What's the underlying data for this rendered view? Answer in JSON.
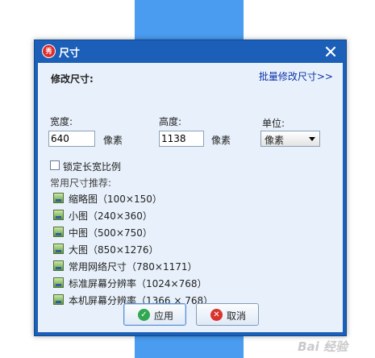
{
  "dialog": {
    "title": "尺寸",
    "app_icon_text": "秀",
    "section_title": "修改尺寸:",
    "batch_link": "批量修改尺寸>>",
    "width_label": "宽度:",
    "width_value": "640",
    "width_unit": "像素",
    "height_label": "高度:",
    "height_value": "1138",
    "height_unit": "像素",
    "unit_label": "单位:",
    "unit_selected": "像素",
    "lock_ratio_label": "锁定长宽比例",
    "lock_ratio_checked": false,
    "recommend_title": "常用尺寸推荐:",
    "presets": [
      "缩略图（100×150）",
      "小图（240×360）",
      "中图（500×750）",
      "大图（850×1276）",
      "常用网络尺寸（780×1171）",
      "标准屏幕分辨率（1024×768）",
      "本机屏幕分辨率（1366 × 768）"
    ],
    "apply_label": "应用",
    "cancel_label": "取消"
  },
  "watermark": "Bai 经验",
  "colors": {
    "titlebar": "#1b5fb8",
    "client_bg": "#e8f1fb",
    "link": "#0b33a8",
    "apply_icon": "#2fa84f",
    "cancel_icon": "#d9342b",
    "background_strip": "#4a9cf0"
  },
  "icons": {
    "app": "meitu-app-icon",
    "close": "close-icon",
    "preset": "image-preset-icon",
    "apply": "check-circle-icon",
    "cancel": "x-circle-icon"
  }
}
